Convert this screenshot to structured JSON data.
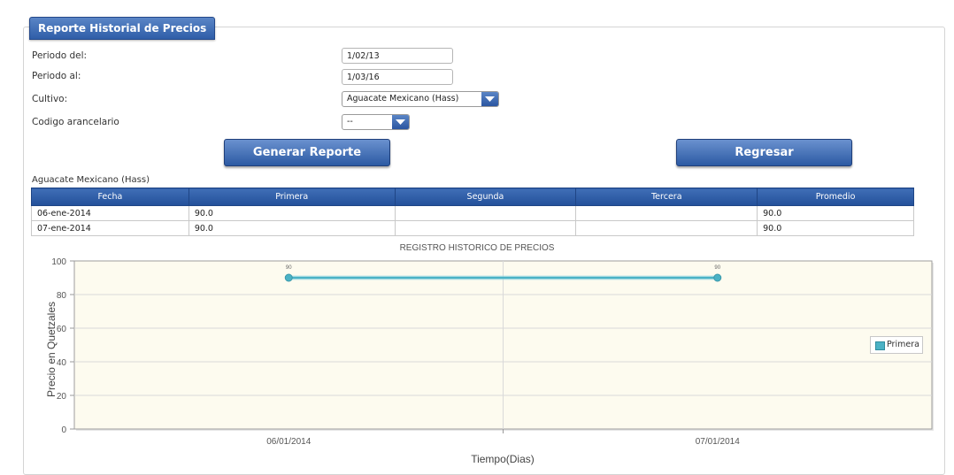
{
  "form": {
    "title": "Reporte Historial de Precios",
    "periodo_del_label": "Periodo del:",
    "periodo_del_value": "1/02/13",
    "periodo_al_label": "Periodo al:",
    "periodo_al_value": "1/03/16",
    "cultivo_label": "Cultivo:",
    "cultivo_value": "Aguacate Mexicano (Hass)",
    "codigo_label": "Codigo arancelario",
    "codigo_value": "--",
    "generar_label": "Generar Reporte",
    "regresar_label": "Regresar"
  },
  "report": {
    "crop_name": "Aguacate Mexicano (Hass)",
    "columns": [
      "Fecha",
      "Primera",
      "Segunda",
      "Tercera",
      "Promedio"
    ],
    "rows": [
      [
        "06-ene-2014",
        "90.0",
        "",
        "",
        "90.0"
      ],
      [
        "07-ene-2014",
        "90.0",
        "",
        "",
        "90.0"
      ]
    ]
  },
  "chart_data": {
    "type": "line",
    "title": "REGISTRO HISTORICO DE PRECIOS",
    "xlabel": "Tiempo(Dias)",
    "ylabel": "Precio en Quetzales",
    "categories": [
      "06/01/2014",
      "07/01/2014"
    ],
    "ylim": [
      0,
      100
    ],
    "yticks": [
      0,
      20,
      40,
      60,
      80,
      100
    ],
    "series": [
      {
        "name": "Primera",
        "values": [
          90,
          90
        ],
        "color": "#4bb2c5"
      }
    ],
    "point_labels": [
      "90",
      "90"
    ],
    "grid": true,
    "legend": "right"
  },
  "colors": {
    "plot_background": "#fdfbef",
    "header_blue": "#2f5ea8",
    "series": "#4bb2c5"
  }
}
